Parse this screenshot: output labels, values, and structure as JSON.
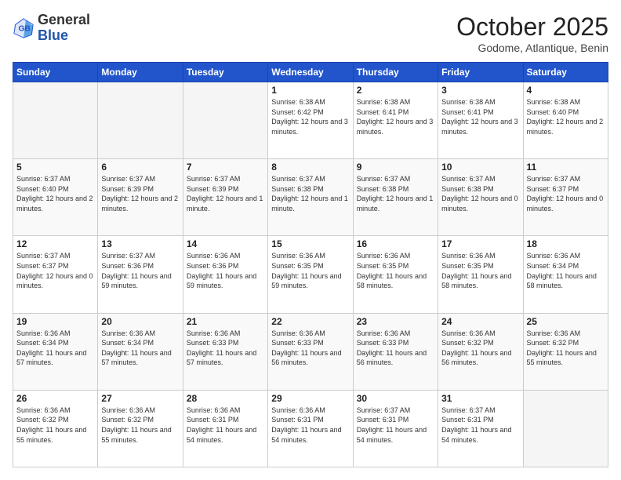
{
  "logo": {
    "general": "General",
    "blue": "Blue"
  },
  "header": {
    "month": "October 2025",
    "location": "Godome, Atlantique, Benin"
  },
  "weekdays": [
    "Sunday",
    "Monday",
    "Tuesday",
    "Wednesday",
    "Thursday",
    "Friday",
    "Saturday"
  ],
  "weeks": [
    [
      {
        "day": "",
        "sunrise": "",
        "sunset": "",
        "daylight": ""
      },
      {
        "day": "",
        "sunrise": "",
        "sunset": "",
        "daylight": ""
      },
      {
        "day": "",
        "sunrise": "",
        "sunset": "",
        "daylight": ""
      },
      {
        "day": "1",
        "sunrise": "6:38 AM",
        "sunset": "6:42 PM",
        "daylight": "12 hours and 3 minutes."
      },
      {
        "day": "2",
        "sunrise": "6:38 AM",
        "sunset": "6:41 PM",
        "daylight": "12 hours and 3 minutes."
      },
      {
        "day": "3",
        "sunrise": "6:38 AM",
        "sunset": "6:41 PM",
        "daylight": "12 hours and 3 minutes."
      },
      {
        "day": "4",
        "sunrise": "6:38 AM",
        "sunset": "6:40 PM",
        "daylight": "12 hours and 2 minutes."
      }
    ],
    [
      {
        "day": "5",
        "sunrise": "6:37 AM",
        "sunset": "6:40 PM",
        "daylight": "12 hours and 2 minutes."
      },
      {
        "day": "6",
        "sunrise": "6:37 AM",
        "sunset": "6:39 PM",
        "daylight": "12 hours and 2 minutes."
      },
      {
        "day": "7",
        "sunrise": "6:37 AM",
        "sunset": "6:39 PM",
        "daylight": "12 hours and 1 minute."
      },
      {
        "day": "8",
        "sunrise": "6:37 AM",
        "sunset": "6:38 PM",
        "daylight": "12 hours and 1 minute."
      },
      {
        "day": "9",
        "sunrise": "6:37 AM",
        "sunset": "6:38 PM",
        "daylight": "12 hours and 1 minute."
      },
      {
        "day": "10",
        "sunrise": "6:37 AM",
        "sunset": "6:38 PM",
        "daylight": "12 hours and 0 minutes."
      },
      {
        "day": "11",
        "sunrise": "6:37 AM",
        "sunset": "6:37 PM",
        "daylight": "12 hours and 0 minutes."
      }
    ],
    [
      {
        "day": "12",
        "sunrise": "6:37 AM",
        "sunset": "6:37 PM",
        "daylight": "12 hours and 0 minutes."
      },
      {
        "day": "13",
        "sunrise": "6:37 AM",
        "sunset": "6:36 PM",
        "daylight": "11 hours and 59 minutes."
      },
      {
        "day": "14",
        "sunrise": "6:36 AM",
        "sunset": "6:36 PM",
        "daylight": "11 hours and 59 minutes."
      },
      {
        "day": "15",
        "sunrise": "6:36 AM",
        "sunset": "6:35 PM",
        "daylight": "11 hours and 59 minutes."
      },
      {
        "day": "16",
        "sunrise": "6:36 AM",
        "sunset": "6:35 PM",
        "daylight": "11 hours and 58 minutes."
      },
      {
        "day": "17",
        "sunrise": "6:36 AM",
        "sunset": "6:35 PM",
        "daylight": "11 hours and 58 minutes."
      },
      {
        "day": "18",
        "sunrise": "6:36 AM",
        "sunset": "6:34 PM",
        "daylight": "11 hours and 58 minutes."
      }
    ],
    [
      {
        "day": "19",
        "sunrise": "6:36 AM",
        "sunset": "6:34 PM",
        "daylight": "11 hours and 57 minutes."
      },
      {
        "day": "20",
        "sunrise": "6:36 AM",
        "sunset": "6:34 PM",
        "daylight": "11 hours and 57 minutes."
      },
      {
        "day": "21",
        "sunrise": "6:36 AM",
        "sunset": "6:33 PM",
        "daylight": "11 hours and 57 minutes."
      },
      {
        "day": "22",
        "sunrise": "6:36 AM",
        "sunset": "6:33 PM",
        "daylight": "11 hours and 56 minutes."
      },
      {
        "day": "23",
        "sunrise": "6:36 AM",
        "sunset": "6:33 PM",
        "daylight": "11 hours and 56 minutes."
      },
      {
        "day": "24",
        "sunrise": "6:36 AM",
        "sunset": "6:32 PM",
        "daylight": "11 hours and 56 minutes."
      },
      {
        "day": "25",
        "sunrise": "6:36 AM",
        "sunset": "6:32 PM",
        "daylight": "11 hours and 55 minutes."
      }
    ],
    [
      {
        "day": "26",
        "sunrise": "6:36 AM",
        "sunset": "6:32 PM",
        "daylight": "11 hours and 55 minutes."
      },
      {
        "day": "27",
        "sunrise": "6:36 AM",
        "sunset": "6:32 PM",
        "daylight": "11 hours and 55 minutes."
      },
      {
        "day": "28",
        "sunrise": "6:36 AM",
        "sunset": "6:31 PM",
        "daylight": "11 hours and 54 minutes."
      },
      {
        "day": "29",
        "sunrise": "6:36 AM",
        "sunset": "6:31 PM",
        "daylight": "11 hours and 54 minutes."
      },
      {
        "day": "30",
        "sunrise": "6:37 AM",
        "sunset": "6:31 PM",
        "daylight": "11 hours and 54 minutes."
      },
      {
        "day": "31",
        "sunrise": "6:37 AM",
        "sunset": "6:31 PM",
        "daylight": "11 hours and 54 minutes."
      },
      {
        "day": "",
        "sunrise": "",
        "sunset": "",
        "daylight": ""
      }
    ]
  ]
}
